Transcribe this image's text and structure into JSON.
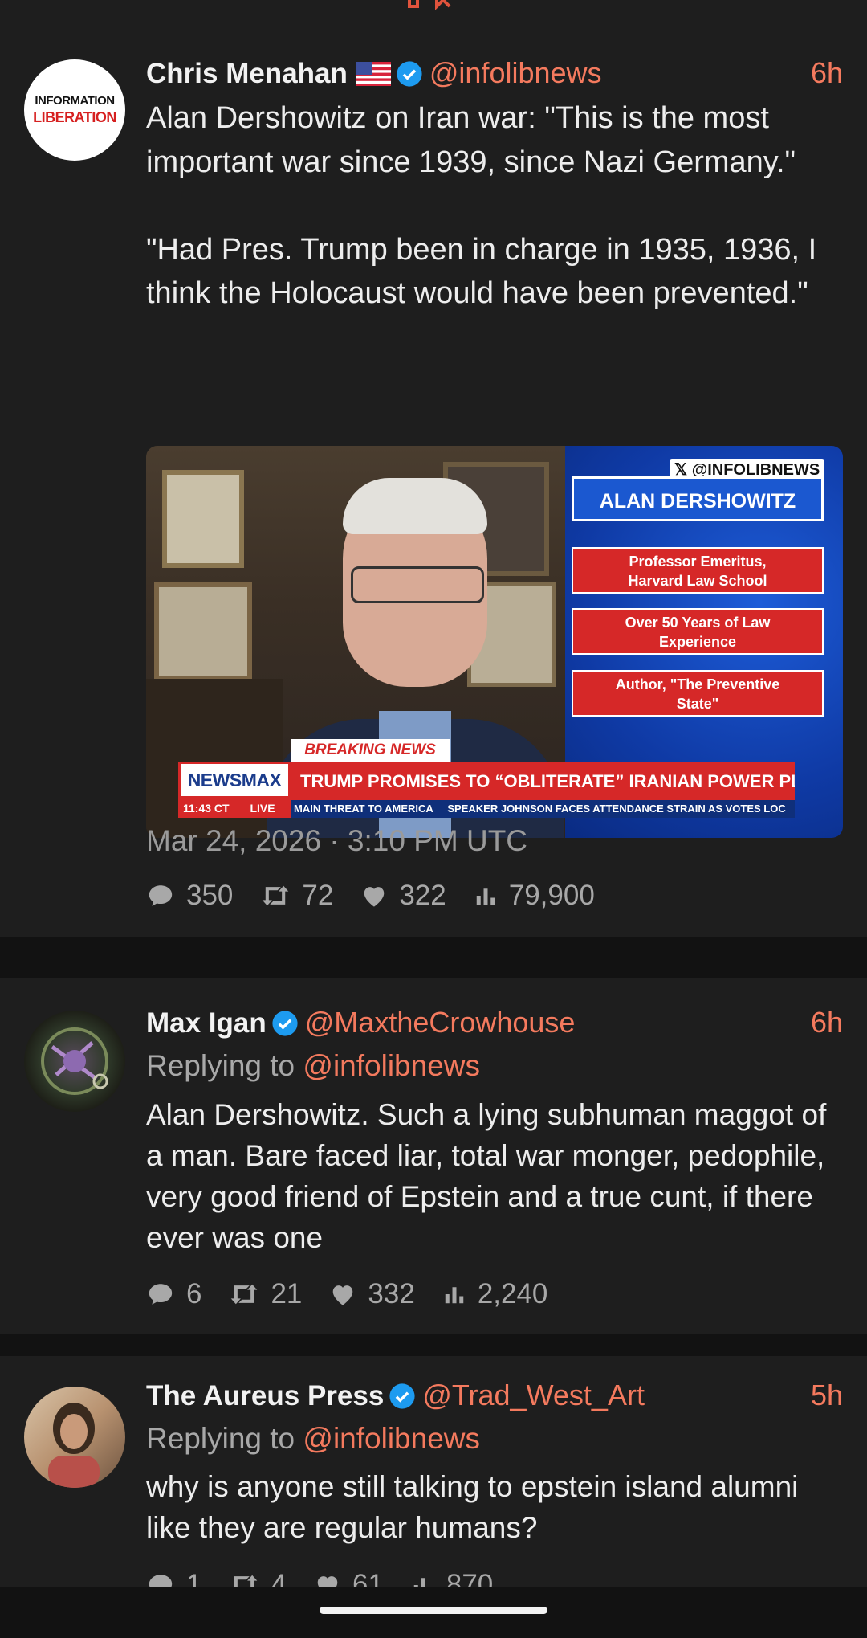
{
  "posts": [
    {
      "author": "Chris Menahan",
      "handle": "@infolibnews",
      "time": "6h",
      "avatar_text": [
        "INFORMATION",
        "LIBERATION"
      ],
      "text": "Alan Dershowitz on Iran war: \"This is the most important war since 1939, since Nazi Germany.\"\n\n\"Had Pres. Trump been in charge in 1935, 1936, I think the Holocaust would have been prevented.\"",
      "media": {
        "watermark": "@INFOLIBNEWS",
        "guest_name": "ALAN DERSHOWITZ",
        "credentials": [
          "Professor Emeritus, Harvard Law School",
          "Over 50 Years of Law Experience",
          "Author, \"The Preventive State\""
        ],
        "breaking_label": "BREAKING NEWS",
        "network": "NEWSMAX",
        "headline": "TRUMP PROMISES TO “OBLITERATE” IRANIAN POWER PLANTS",
        "clock": "11:43 CT",
        "live": "LIVE",
        "ticker": "MAIN THREAT TO AMERICA     SPEAKER JOHNSON FACES ATTENDANCE STRAIN AS VOTES LOC"
      },
      "date": "Mar 24, 2026 · 3:10 PM UTC",
      "stats": {
        "replies": "350",
        "retweets": "72",
        "likes": "322",
        "views": "79,900"
      }
    },
    {
      "author": "Max Igan",
      "handle": "@MaxtheCrowhouse",
      "time": "6h",
      "replying_prefix": "Replying to",
      "replying_to": "@infolibnews",
      "text": "Alan Dershowitz. Such a lying subhuman maggot of a man. Bare faced liar, total war monger, pedophile, very good friend of Epstein and a true cunt, if there ever was one",
      "stats": {
        "replies": "6",
        "retweets": "21",
        "likes": "332",
        "views": "2,240"
      }
    },
    {
      "author": "The Aureus Press",
      "handle": "@Trad_West_Art",
      "time": "5h",
      "replying_prefix": "Replying to",
      "replying_to": "@infolibnews",
      "text": "why is anyone still talking to epstein island alumni like they are regular humans?",
      "stats": {
        "replies": "1",
        "retweets": "4",
        "likes": "61",
        "views": "870"
      }
    }
  ],
  "colors": {
    "accent": "#f47a5e",
    "verified": "#1d9bf0",
    "background": "#121212",
    "card": "#1e1e1e"
  },
  "icons": [
    "reply-icon",
    "retweet-icon",
    "like-icon",
    "views-icon",
    "verified-icon",
    "us-flag-icon"
  ]
}
